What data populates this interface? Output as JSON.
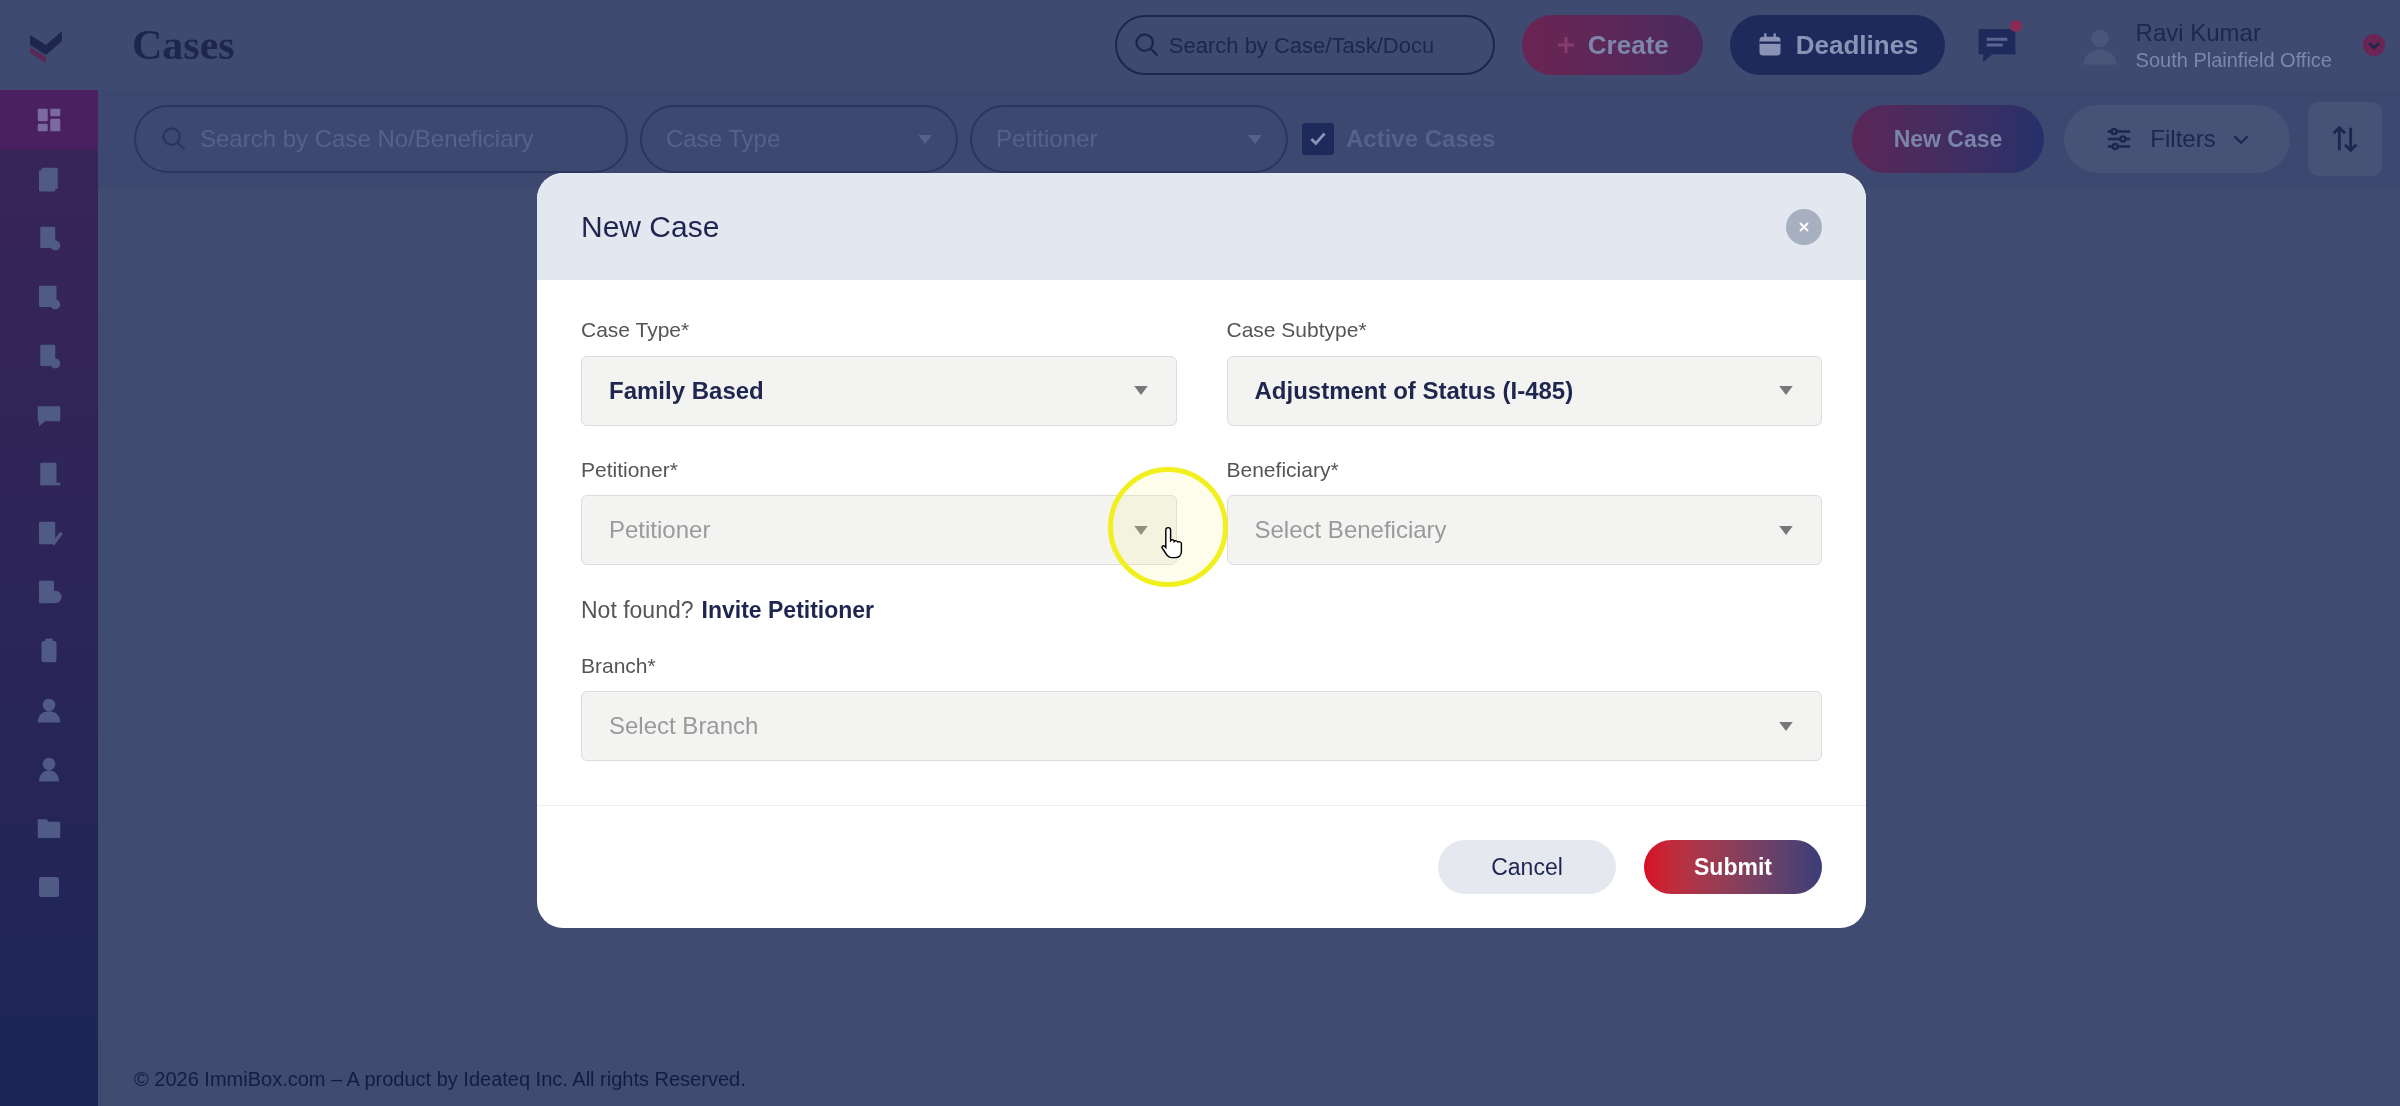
{
  "header": {
    "title": "Cases",
    "search": {
      "placeholder": "Search by Case/Task/Docu"
    },
    "create_button": "Create",
    "deadlines_button": "Deadlines",
    "notifications": {
      "unread": true
    },
    "user": {
      "name": "Ravi Kumar",
      "office": "South Plainfield Office"
    }
  },
  "sidebar": {
    "items": [
      {
        "selected": true
      },
      {
        "selected": false
      },
      {
        "selected": false
      },
      {
        "selected": false
      },
      {
        "selected": false
      },
      {
        "selected": false
      },
      {
        "selected": false
      },
      {
        "selected": false
      },
      {
        "selected": false
      },
      {
        "selected": false
      },
      {
        "selected": false
      },
      {
        "selected": false
      },
      {
        "selected": false
      },
      {
        "selected": false
      }
    ]
  },
  "toolbar": {
    "search": {
      "placeholder": "Search by Case No/Beneficiary"
    },
    "filters": [
      {
        "placeholder": "Case Type"
      },
      {
        "placeholder": "Petitioner"
      }
    ],
    "active_cases": {
      "label": "Active Cases",
      "checked": true
    },
    "new_case_button": "New Case",
    "filters_button": "Filters"
  },
  "dialog": {
    "title": "New Case",
    "fields": [
      {
        "label": "Case Type*",
        "value": "Family Based"
      },
      {
        "label": "Case Subtype*",
        "value": "Adjustment of Status (I-485)"
      },
      {
        "label": "Petitioner*",
        "placeholder": "Petitioner"
      },
      {
        "label": "Beneficiary*",
        "placeholder": "Select Beneficiary"
      }
    ],
    "hint": {
      "text": "Not found?",
      "link": "Invite Petitioner"
    },
    "branch": {
      "label": "Branch*",
      "placeholder": "Select Branch"
    },
    "buttons": {
      "cancel": "Cancel",
      "submit": "Submit"
    }
  },
  "footer": "© 2026 ImmiBox.com – A product by Ideateq Inc. All rights Reserved."
}
